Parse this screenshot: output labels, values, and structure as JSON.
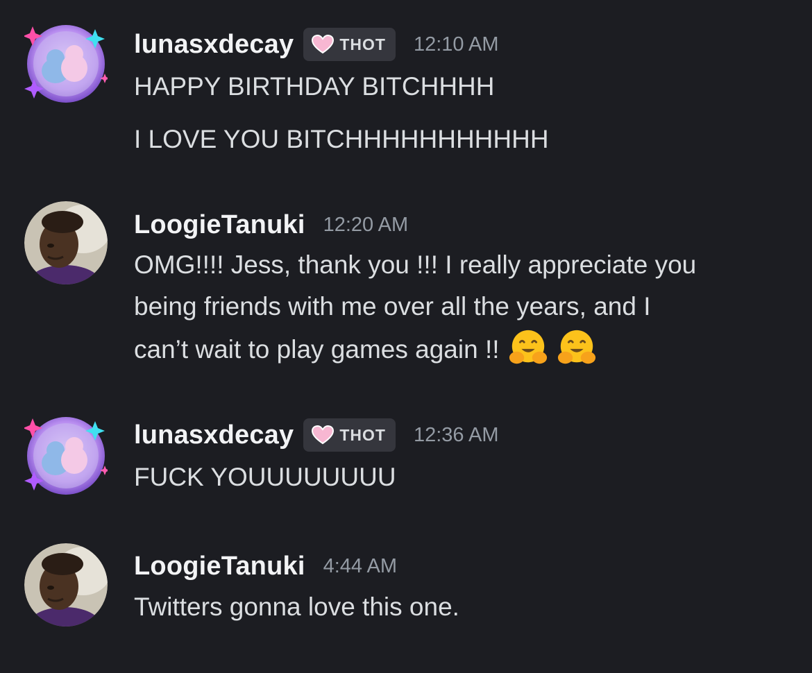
{
  "messages": [
    {
      "username": "lunasxdecay",
      "tag": "THOT",
      "timestamp": "12:10 AM",
      "lines": [
        "HAPPY BIRTHDAY BITCHHHH",
        "I LOVE YOU BITCHHHHHHHHHHH"
      ]
    },
    {
      "username": "LoogieTanuki",
      "timestamp": "12:20 AM",
      "lines": [
        "OMG!!!! Jess, thank you !!! I really appreciate you",
        "being friends with me over all the years, and I",
        "can’t wait to play games again !!"
      ],
      "emojis": [
        "hugging-face-emoji",
        "hugging-face-emoji"
      ]
    },
    {
      "username": "lunasxdecay",
      "tag": "THOT",
      "timestamp": "12:36 AM",
      "lines": [
        "FUCK YOUUUUUUUU"
      ]
    },
    {
      "username": "LoogieTanuki",
      "timestamp": "4:44 AM",
      "lines": [
        "Twitters gonna love this one."
      ]
    }
  ],
  "colors": {
    "background": "#1c1d22",
    "username": "#f2f3f5",
    "text": "#dbdee1",
    "timestamp": "#949ba4",
    "tag_background": "#35363d",
    "tag_heart": "#f7b7d2"
  }
}
